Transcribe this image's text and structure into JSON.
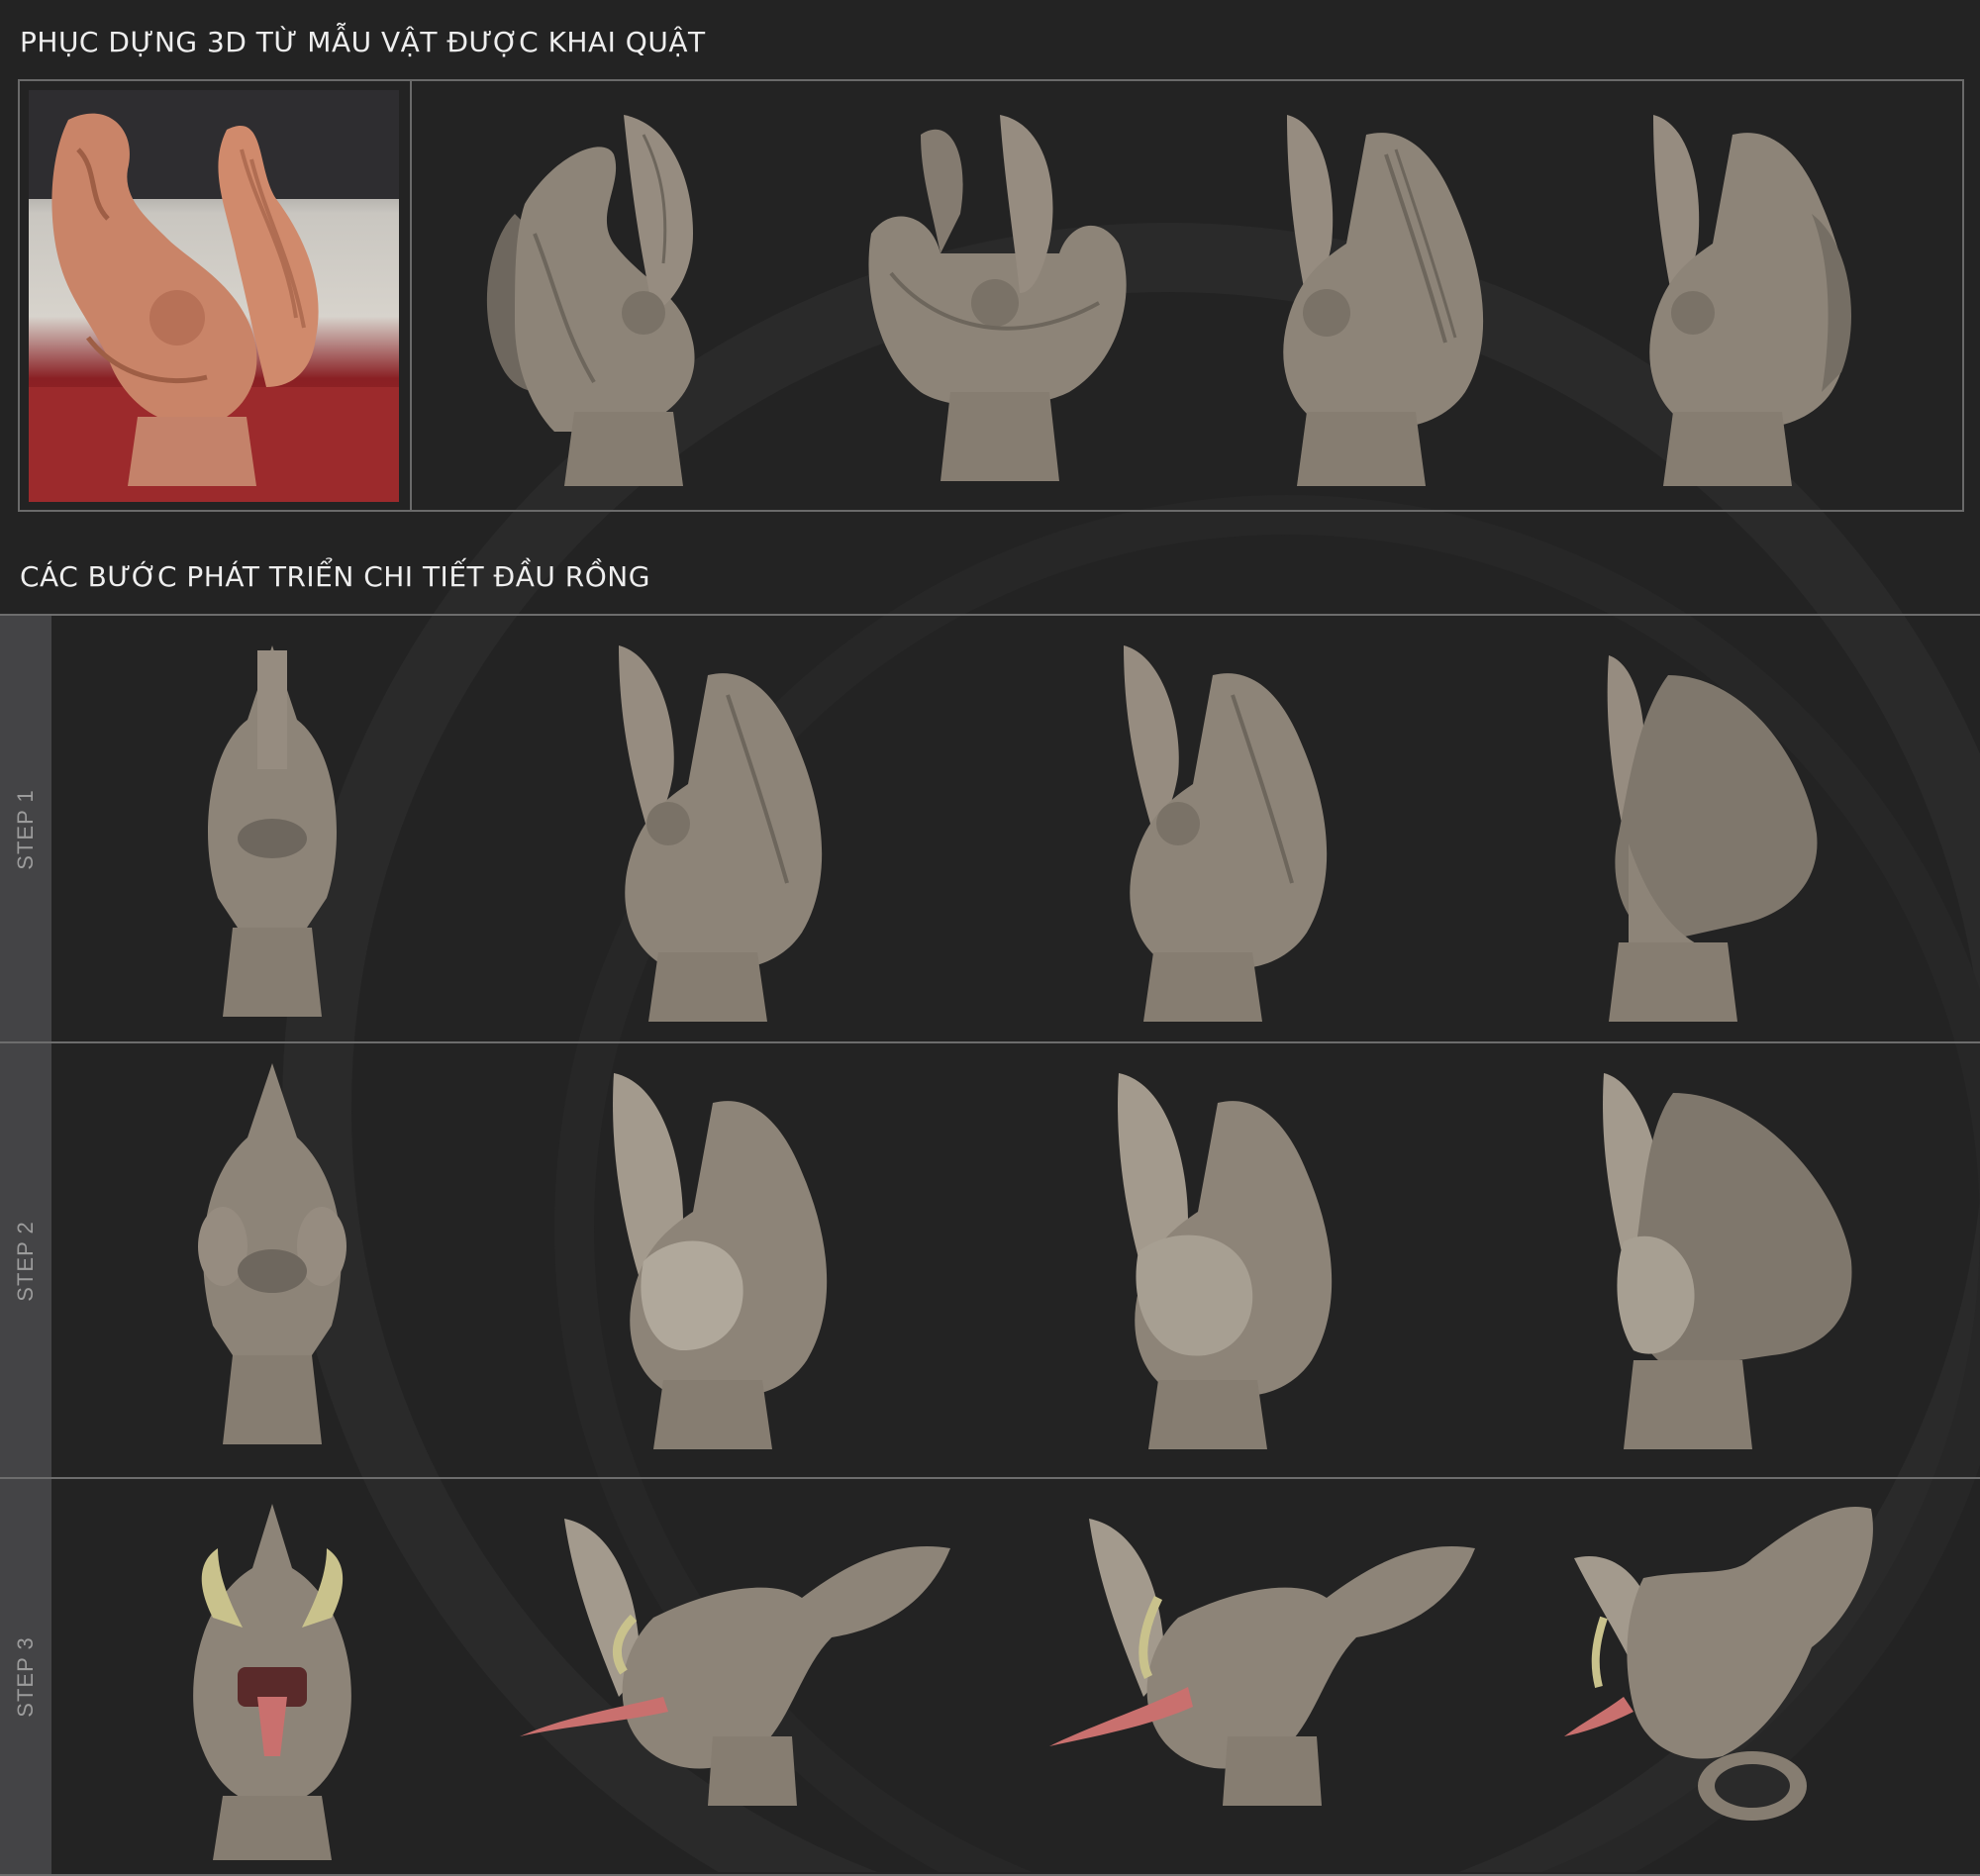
{
  "titles": {
    "reconstruction": "PHỤC DỰNG 3D TỪ MẪU VẬT ĐƯỢC KHAI QUẬT",
    "development": "CÁC BƯỚC PHÁT TRIỂN CHI TIẾT ĐẦU RỒNG"
  },
  "steps": [
    "STEP 1",
    "STEP 2",
    "STEP 3"
  ],
  "colors": {
    "background": "#232323",
    "sculpt_clay": "#8d8478",
    "terracotta": "#c98468",
    "horn": "#c9c28c",
    "tongue": "#c9706e",
    "step_band": "#444446"
  }
}
